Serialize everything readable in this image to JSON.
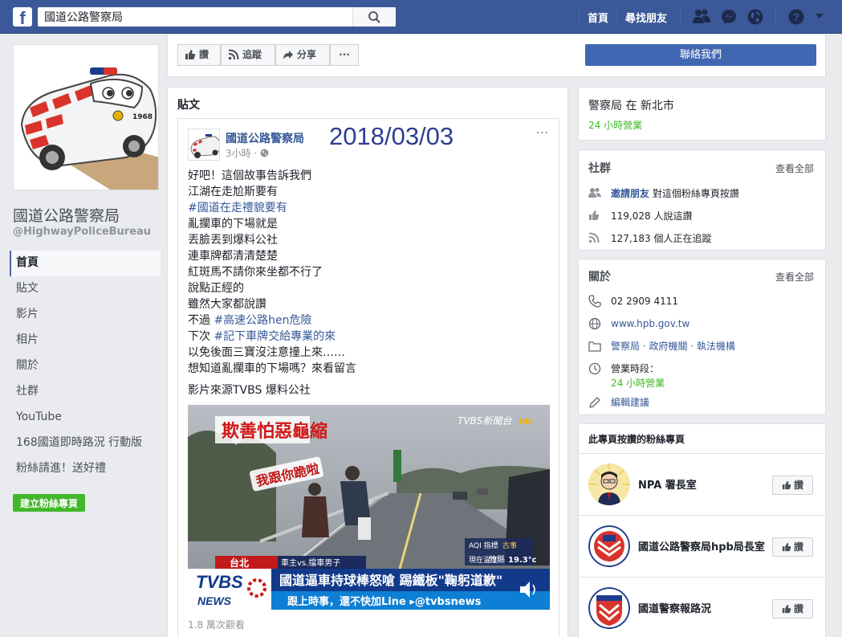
{
  "topbar": {
    "logo": "f",
    "search_value": "國道公路警察局",
    "nav_home": "首頁",
    "nav_find_friends": "尋找朋友"
  },
  "page": {
    "name": "國道公路警察局",
    "handle": "@HighwayPoliceBureau",
    "car_number": "1968"
  },
  "sidebar": {
    "items": [
      {
        "label": "首頁"
      },
      {
        "label": "貼文"
      },
      {
        "label": "影片"
      },
      {
        "label": "相片"
      },
      {
        "label": "關於"
      },
      {
        "label": "社群"
      },
      {
        "label": "YouTube"
      },
      {
        "label": "168國道即時路況 行動版"
      },
      {
        "label": "粉絲請進！送好禮"
      }
    ],
    "create_page": "建立粉絲專頁"
  },
  "actions": {
    "like": "讚",
    "follow": "追蹤",
    "share": "分享",
    "more": "···",
    "contact": "聯絡我們"
  },
  "posts": {
    "heading": "貼文",
    "post": {
      "author": "國道公路警察局",
      "time": "3小時 ·",
      "date_overlay": "2018/03/03",
      "more": "···",
      "lines": [
        {
          "text": "好吧！這個故事告訴我們",
          "tag": false
        },
        {
          "text": "江湖在走尬斯要有",
          "tag": false
        },
        {
          "text": "#國道在走禮貌要有",
          "tag": true
        },
        {
          "text": "亂攔車的下場就是",
          "tag": false
        },
        {
          "text": "丟臉丟到爆料公社",
          "tag": false
        },
        {
          "text": "連車牌都清清楚楚",
          "tag": false
        },
        {
          "text": "紅斑馬不請你來坐都不行了",
          "tag": false
        },
        {
          "text": "說點正經的",
          "tag": false
        },
        {
          "text": "雖然大家都說讚",
          "tag": false
        }
      ],
      "line_10_prefix": "不過 ",
      "line_10_tag": "#高速公路hen危險",
      "line_11_prefix": "下次 ",
      "line_11_tag": "#記下車牌交給專業的來",
      "line_12": "以免後面三寶沒注意撞上來……",
      "line_13": "想知道亂攔車的下場嗎？來看留言",
      "source": "影片來源TVBS 爆料公社",
      "views": "1.8 萬次觀看",
      "video": {
        "title_tag": "欺善怕惡龜縮",
        "bubble": "我跟你跪啦",
        "watermark": "TVBS新聞台",
        "hd": "HD",
        "location": "台北",
        "sub_tag": "車主vs.擋車男子",
        "headline": "國道逼車持球棒怒嗆 踢鐵板\"鞠躬道歉\"",
        "ticker": "跟上時事，還不快加Line ▸@tvbsnews",
        "logo_top": "TVBS",
        "logo_bottom": "NEWS",
        "weather_label": "現在溫度",
        "weather_city": "竹縣",
        "weather_temp": "19.3°c",
        "weather_aqi": "AQI 指標",
        "weather_aqi_val": "古事"
      }
    }
  },
  "about_box": {
    "title": "警察局 在 新北市",
    "hours": "24 小時營業"
  },
  "community": {
    "title": "社群",
    "see_all": "查看全部",
    "invite_link": "邀請朋友",
    "invite_text": "對這個粉絲專頁按讚",
    "likes": "119,028 人說這讚",
    "follows": "127,183 個人正在追蹤"
  },
  "about": {
    "title": "關於",
    "see_all": "查看全部",
    "phone": "02 2909 4111",
    "website": "www.hpb.gov.tw",
    "categories": "警察局 · 政府機關 · 執法機構",
    "hours_label": "營業時段：",
    "hours_value": "24 小時營業",
    "suggest_edits": "編輯建議"
  },
  "liked_pages": {
    "title": "此專頁按讚的粉絲專頁",
    "items": [
      {
        "name": "NPA 署長室",
        "like": "讚"
      },
      {
        "name": "國道公路警察局hpb局長室",
        "like": "讚"
      },
      {
        "name": "國道警察報路況",
        "like": "讚"
      }
    ]
  },
  "colors": {
    "fb_blue": "#3b5998",
    "link_blue": "#365899",
    "green": "#42b72a",
    "date_overlay": "#2e3f8f"
  }
}
